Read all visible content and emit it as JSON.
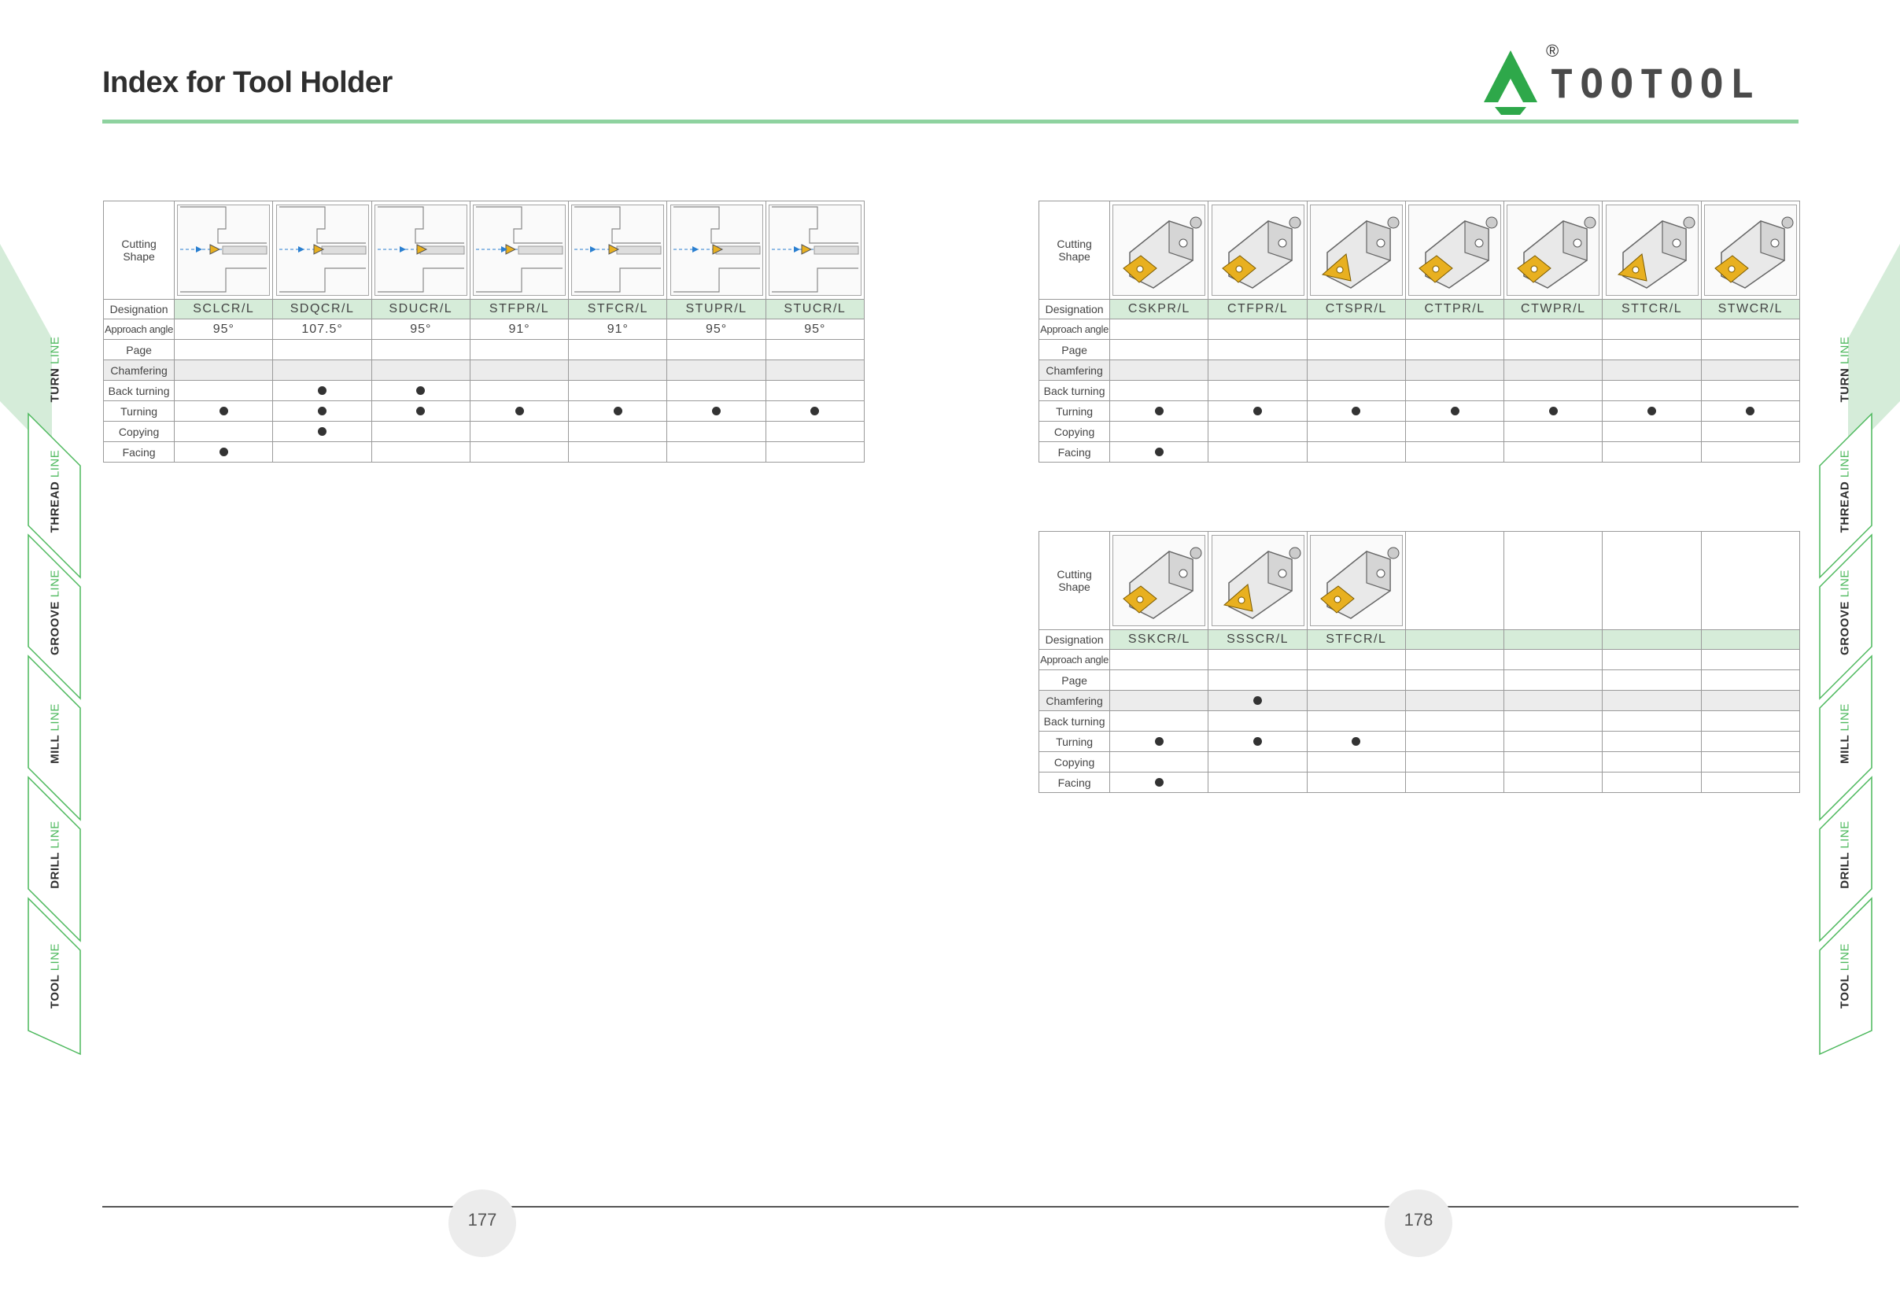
{
  "header": {
    "title": "Index for Tool Holder"
  },
  "logo": {
    "brand": "TOOTOOL",
    "registered": "®"
  },
  "colors": {
    "accent": "#8ed29f",
    "designation_fill": "#d6ecd9",
    "insert_gold": "#e8b020",
    "path_blue": "#2a7fd0"
  },
  "row_labels": {
    "shape": [
      "Cutting",
      "Shape"
    ],
    "designation": "Designation",
    "approach": "Approach angle",
    "page": "Page",
    "chamfering": "Chamfering",
    "back": "Back turning",
    "turning": "Turning",
    "copying": "Copying",
    "facing": "Facing"
  },
  "tables": [
    {
      "designations": [
        "SCLCR/L",
        "SDQCR/L",
        "SDUCR/L",
        "STFPR/L",
        "STFCR/L",
        "STUPR/L",
        "STUCR/L"
      ],
      "approach": [
        "95°",
        "107.5°",
        "95°",
        "91°",
        "91°",
        "95°",
        "95°"
      ],
      "marks": {
        "chamfering": [],
        "back": [
          1,
          2
        ],
        "turning": [
          0,
          1,
          2,
          3,
          4,
          5,
          6
        ],
        "copying": [
          1
        ],
        "facing": [
          0
        ]
      }
    },
    {
      "designations": [
        "CSKPR/L",
        "CTFPR/L",
        "CTSPR/L",
        "CTTPR/L",
        "CTWPR/L",
        "STTCR/L",
        "STWCR/L"
      ],
      "approach": [
        "",
        "",
        "",
        "",
        "",
        "",
        ""
      ],
      "marks": {
        "chamfering": [],
        "back": [],
        "turning": [
          0,
          1,
          2,
          3,
          4,
          5,
          6
        ],
        "copying": [],
        "facing": [
          0
        ]
      }
    },
    {
      "designations": [
        "SSKCR/L",
        "SSSCR/L",
        "STFCR/L",
        "",
        "",
        "",
        ""
      ],
      "approach": [
        "",
        "",
        "",
        "",
        "",
        "",
        ""
      ],
      "marks": {
        "chamfering": [
          1
        ],
        "back": [],
        "turning": [
          0,
          1,
          2
        ],
        "copying": [],
        "facing": [
          0
        ]
      }
    }
  ],
  "page_numbers": {
    "left": "177",
    "right": "178"
  },
  "side_tabs": [
    {
      "bold": "TURN",
      "light": "LINE"
    },
    {
      "bold": "THREAD",
      "light": "LINE"
    },
    {
      "bold": "GROOVE",
      "light": "LINE"
    },
    {
      "bold": "MILL",
      "light": "LINE"
    },
    {
      "bold": "DRILL",
      "light": "LINE"
    },
    {
      "bold": "TOOL",
      "light": "LINE"
    }
  ]
}
